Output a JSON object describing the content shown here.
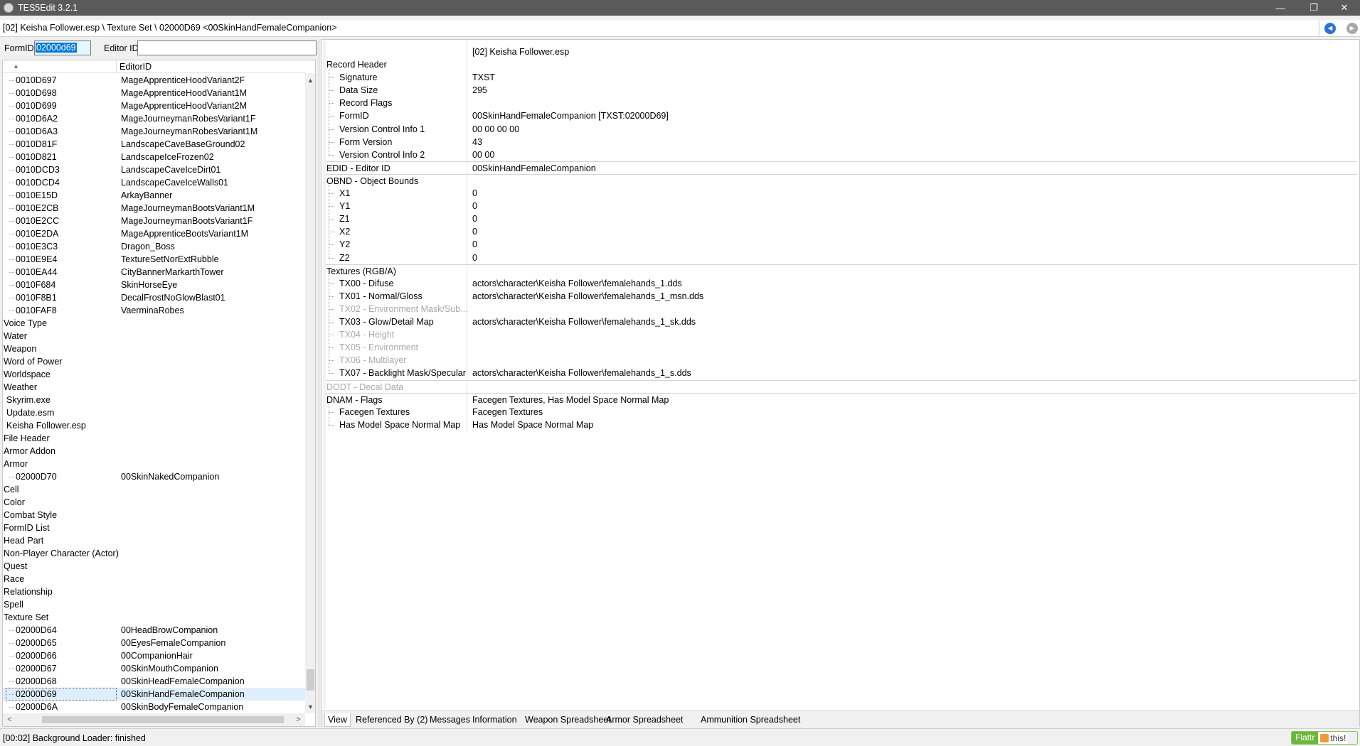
{
  "window": {
    "title": "TES5Edit 3.2.1",
    "min_glyph": "—",
    "restore_glyph": "❐",
    "close_glyph": "✕"
  },
  "path": "[02] Keisha Follower.esp \\ Texture Set \\ 02000D69 <00SkinHandFemaleCompanion>",
  "nav": {
    "back_glyph": "◄",
    "forward_glyph": "►"
  },
  "filter": {
    "formid_label": "FormID",
    "formid_value": "02000d69",
    "editorid_label": "Editor ID",
    "editorid_value": ""
  },
  "left_tree": {
    "header_col1_icon": "▲",
    "header_col2": "EditorID",
    "rows": [
      {
        "c1": "0010D697",
        "c2": "MageApprenticeHoodVariant2F",
        "level": 1
      },
      {
        "c1": "0010D698",
        "c2": "MageApprenticeHoodVariant1M",
        "level": 1
      },
      {
        "c1": "0010D699",
        "c2": "MageApprenticeHoodVariant2M",
        "level": 1
      },
      {
        "c1": "0010D6A2",
        "c2": "MageJourneymanRobesVariant1F",
        "level": 1
      },
      {
        "c1": "0010D6A3",
        "c2": "MageJourneymanRobesVariant1M",
        "level": 1
      },
      {
        "c1": "0010D81F",
        "c2": "LandscapeCaveBaseGround02",
        "level": 1
      },
      {
        "c1": "0010D821",
        "c2": "LandscapeIceFrozen02",
        "level": 1
      },
      {
        "c1": "0010DCD3",
        "c2": "LandscapeCaveIceDirt01",
        "level": 1
      },
      {
        "c1": "0010DCD4",
        "c2": "LandscapeCaveIceWalls01",
        "level": 1
      },
      {
        "c1": "0010E15D",
        "c2": "ArkayBanner",
        "level": 1
      },
      {
        "c1": "0010E2CB",
        "c2": "MageJourneymanBootsVariant1M",
        "level": 1
      },
      {
        "c1": "0010E2CC",
        "c2": "MageJourneymanBootsVariant1F",
        "level": 1
      },
      {
        "c1": "0010E2DA",
        "c2": "MageApprenticeBootsVariant1M",
        "level": 1
      },
      {
        "c1": "0010E3C3",
        "c2": "Dragon_Boss",
        "level": 1
      },
      {
        "c1": "0010E9E4",
        "c2": "TextureSetNorExtRubble",
        "level": 1
      },
      {
        "c1": "0010EA44",
        "c2": "CityBannerMarkarthTower",
        "level": 1
      },
      {
        "c1": "0010F684",
        "c2": "SkinHorseEye",
        "level": 1
      },
      {
        "c1": "0010F8B1",
        "c2": "DecalFrostNoGlowBlast01",
        "level": 1
      },
      {
        "c1": "0010FAF8",
        "c2": "VaerminaRobes",
        "level": 1
      },
      {
        "c1": "Voice Type",
        "c2": "",
        "level": 0
      },
      {
        "c1": "Water",
        "c2": "",
        "level": 0
      },
      {
        "c1": "Weapon",
        "c2": "",
        "level": 0
      },
      {
        "c1": "Word of Power",
        "c2": "",
        "level": 0
      },
      {
        "c1": "Worldspace",
        "c2": "",
        "level": 0
      },
      {
        "c1": "Weather",
        "c2": "",
        "level": 0
      },
      {
        "c1": "Skyrim.exe",
        "c2": "",
        "level": 2
      },
      {
        "c1": "Update.esm",
        "c2": "",
        "level": 2
      },
      {
        "c1": "Keisha Follower.esp",
        "c2": "",
        "level": 2
      },
      {
        "c1": "File Header",
        "c2": "",
        "level": 0
      },
      {
        "c1": "Armor Addon",
        "c2": "",
        "level": 0
      },
      {
        "c1": "Armor",
        "c2": "",
        "level": 0
      },
      {
        "c1": "02000D70",
        "c2": "00SkinNakedCompanion",
        "level": 1
      },
      {
        "c1": "Cell",
        "c2": "",
        "level": 0
      },
      {
        "c1": "Color",
        "c2": "",
        "level": 0
      },
      {
        "c1": "Combat Style",
        "c2": "",
        "level": 0
      },
      {
        "c1": "FormID List",
        "c2": "",
        "level": 0
      },
      {
        "c1": "Head Part",
        "c2": "",
        "level": 0
      },
      {
        "c1": "Non-Player Character (Actor)",
        "c2": "",
        "level": 0
      },
      {
        "c1": "Quest",
        "c2": "",
        "level": 0
      },
      {
        "c1": "Race",
        "c2": "",
        "level": 0
      },
      {
        "c1": "Relationship",
        "c2": "",
        "level": 0
      },
      {
        "c1": "Spell",
        "c2": "",
        "level": 0
      },
      {
        "c1": "Texture Set",
        "c2": "",
        "level": 0
      },
      {
        "c1": "02000D64",
        "c2": "00HeadBrowCompanion",
        "level": 1
      },
      {
        "c1": "02000D65",
        "c2": "00EyesFemaleCompanion",
        "level": 1
      },
      {
        "c1": "02000D66",
        "c2": "00CompanionHair",
        "level": 1
      },
      {
        "c1": "02000D67",
        "c2": "00SkinMouthCompanion",
        "level": 1
      },
      {
        "c1": "02000D68",
        "c2": "00SkinHeadFemaleCompanion",
        "level": 1
      },
      {
        "c1": "02000D69",
        "c2": "00SkinHandFemaleCompanion",
        "level": 1,
        "selected": true
      },
      {
        "c1": "02000D6A",
        "c2": "00SkinBodyFemaleCompanion",
        "level": 1
      }
    ]
  },
  "record": {
    "header_value": "[02] Keisha Follower.esp",
    "rows": [
      {
        "name": "Record Header",
        "value": "",
        "level": 0
      },
      {
        "name": "Signature",
        "value": "TXST",
        "level": 1
      },
      {
        "name": "Data Size",
        "value": "295",
        "level": 1
      },
      {
        "name": "Record Flags",
        "value": "",
        "level": 1
      },
      {
        "name": "FormID",
        "value": "00SkinHandFemaleCompanion [TXST:02000D69]",
        "level": 1
      },
      {
        "name": "Version Control Info 1",
        "value": "00 00 00 00",
        "level": 1
      },
      {
        "name": "Form Version",
        "value": "43",
        "level": 1
      },
      {
        "name": "Version Control Info 2",
        "value": "00 00",
        "level": 1
      },
      {
        "name": "EDID - Editor ID",
        "value": "00SkinHandFemaleCompanion",
        "level": 0,
        "sep": true
      },
      {
        "name": "OBND - Object Bounds",
        "value": "",
        "level": 0,
        "sep": true
      },
      {
        "name": "X1",
        "value": "0",
        "level": 1
      },
      {
        "name": "Y1",
        "value": "0",
        "level": 1
      },
      {
        "name": "Z1",
        "value": "0",
        "level": 1
      },
      {
        "name": "X2",
        "value": "0",
        "level": 1
      },
      {
        "name": "Y2",
        "value": "0",
        "level": 1
      },
      {
        "name": "Z2",
        "value": "0",
        "level": 1
      },
      {
        "name": "Textures (RGB/A)",
        "value": "",
        "level": 0,
        "sep": true
      },
      {
        "name": "TX00 - Difuse",
        "value": "actors\\character\\Keisha Follower\\femalehands_1.dds",
        "level": 1
      },
      {
        "name": "TX01 - Normal/Gloss",
        "value": "actors\\character\\Keisha Follower\\femalehands_1_msn.dds",
        "level": 1
      },
      {
        "name": "TX02 - Environment Mask/Sub...",
        "value": "",
        "level": 1,
        "disabled": true
      },
      {
        "name": "TX03 - Glow/Detail Map",
        "value": "actors\\character\\Keisha Follower\\femalehands_1_sk.dds",
        "level": 1
      },
      {
        "name": "TX04 - Height",
        "value": "",
        "level": 1,
        "disabled": true
      },
      {
        "name": "TX05 - Environment",
        "value": "",
        "level": 1,
        "disabled": true
      },
      {
        "name": "TX06 - Multilayer",
        "value": "",
        "level": 1,
        "disabled": true
      },
      {
        "name": "TX07 - Backlight Mask/Specular",
        "value": "actors\\character\\Keisha Follower\\femalehands_1_s.dds",
        "level": 1
      },
      {
        "name": "DODT - Decal Data",
        "value": "",
        "level": 0,
        "sep": true,
        "disabled": true
      },
      {
        "name": "DNAM - Flags",
        "value": "Facegen Textures, Has Model Space Normal Map",
        "level": 0,
        "sep": true
      },
      {
        "name": "Facegen Textures",
        "value": "Facegen Textures",
        "level": 1
      },
      {
        "name": "Has Model Space Normal Map",
        "value": "Has Model Space Normal Map",
        "level": 1
      }
    ]
  },
  "tabs": [
    "View",
    "Referenced By (2)",
    "Messages",
    "Information",
    "Weapon Spreadsheet",
    "Armor Spreadsheet",
    "Ammunition Spreadsheet"
  ],
  "active_tab": 0,
  "status": "[00:02] Background Loader: finished",
  "flattr": {
    "label": "Flattr",
    "this_label": "this!"
  },
  "scroll_glyphs": {
    "up": "▲",
    "down": "▼",
    "left": "<",
    "right": ">"
  }
}
